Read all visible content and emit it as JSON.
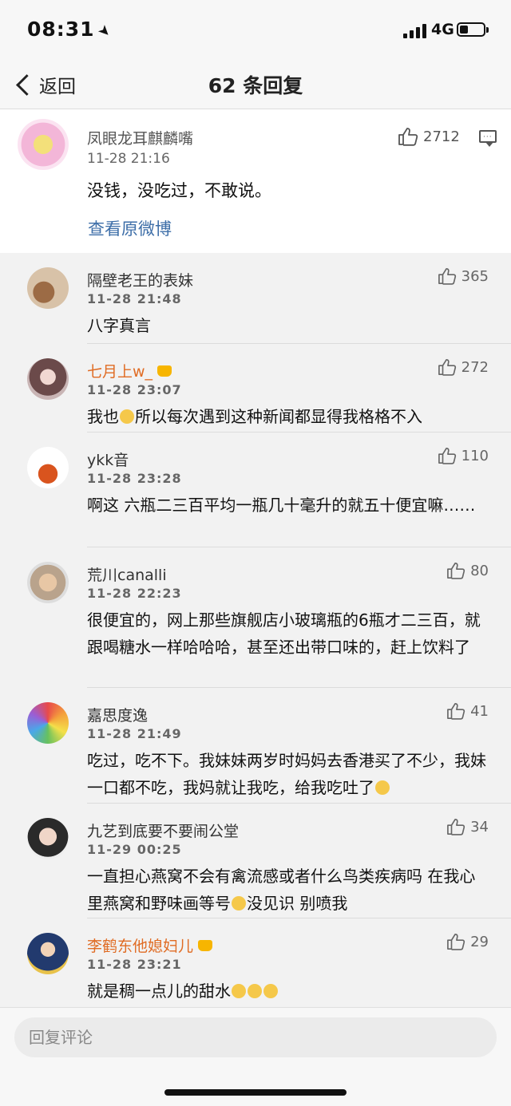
{
  "status": {
    "time": "08:31",
    "network": "4G"
  },
  "nav": {
    "back_label": "返回",
    "title": "62 条回复"
  },
  "original": {
    "author": "凤眼龙耳麒麟嘴",
    "time": "11-28 21:16",
    "text": "没钱，没吃过，不敢说。",
    "likes": "2712",
    "view_original": "查看原微博"
  },
  "replies": [
    {
      "name": "隔壁老王的表妹",
      "time": "11-28 21:48",
      "likes": "365",
      "text": "八字真言"
    },
    {
      "name": "七月上w_",
      "time": "11-28 23:07",
      "likes": "272",
      "text_a": "我也",
      "text_b": "所以每次遇到这种新闻都显得我格格不入"
    },
    {
      "name": "ykk音",
      "time": "11-28 23:28",
      "likes": "110",
      "text": "啊这 六瓶二三百平均一瓶几十毫升的就五十便宜嘛……"
    },
    {
      "name": "荒川canalli",
      "time": "11-28 22:23",
      "likes": "80",
      "text": "很便宜的，网上那些旗舰店小玻璃瓶的6瓶才二三百，就跟喝糖水一样哈哈哈，甚至还出带口味的，赶上饮料了"
    },
    {
      "name": "嘉思度逸",
      "time": "11-28 21:49",
      "likes": "41",
      "text": "吃过，吃不下。我妹妹两岁时妈妈去香港买了不少，我妹一口都不吃，我妈就让我吃，给我吃吐了"
    },
    {
      "name": "九艺到底要不要闹公堂",
      "time": "11-29 00:25",
      "likes": "34",
      "text_a": "一直担心燕窝不会有禽流感或者什么鸟类疾病吗 在我心里燕窝和野味画等号",
      "text_b": "没见识 别喷我"
    },
    {
      "name": "李鹤东他媳妇儿",
      "time": "11-28 23:21",
      "likes": "29",
      "text": "就是稠一点儿的甜水"
    }
  ],
  "bottom": {
    "placeholder": "回复评论"
  }
}
